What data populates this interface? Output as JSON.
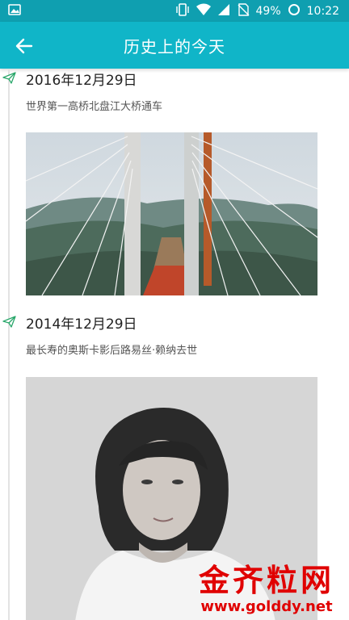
{
  "status_bar": {
    "battery": "49%",
    "time": "10:22"
  },
  "app_bar": {
    "title": "历史上的今天"
  },
  "entries": [
    {
      "date": "2016年12月29日",
      "description": "世界第一高桥北盘江大桥通车",
      "image": "bridge-photo"
    },
    {
      "date": "2014年12月29日",
      "description": "最长寿的奥斯卡影后路易丝·赖纳去世",
      "image": "portrait-photo"
    }
  ],
  "watermark": {
    "name": "金齐粒网",
    "url": "www.golddy.net"
  },
  "colors": {
    "status_bar": "#0f9fb0",
    "app_bar": "#10b5c8",
    "watermark": "#e00000"
  }
}
